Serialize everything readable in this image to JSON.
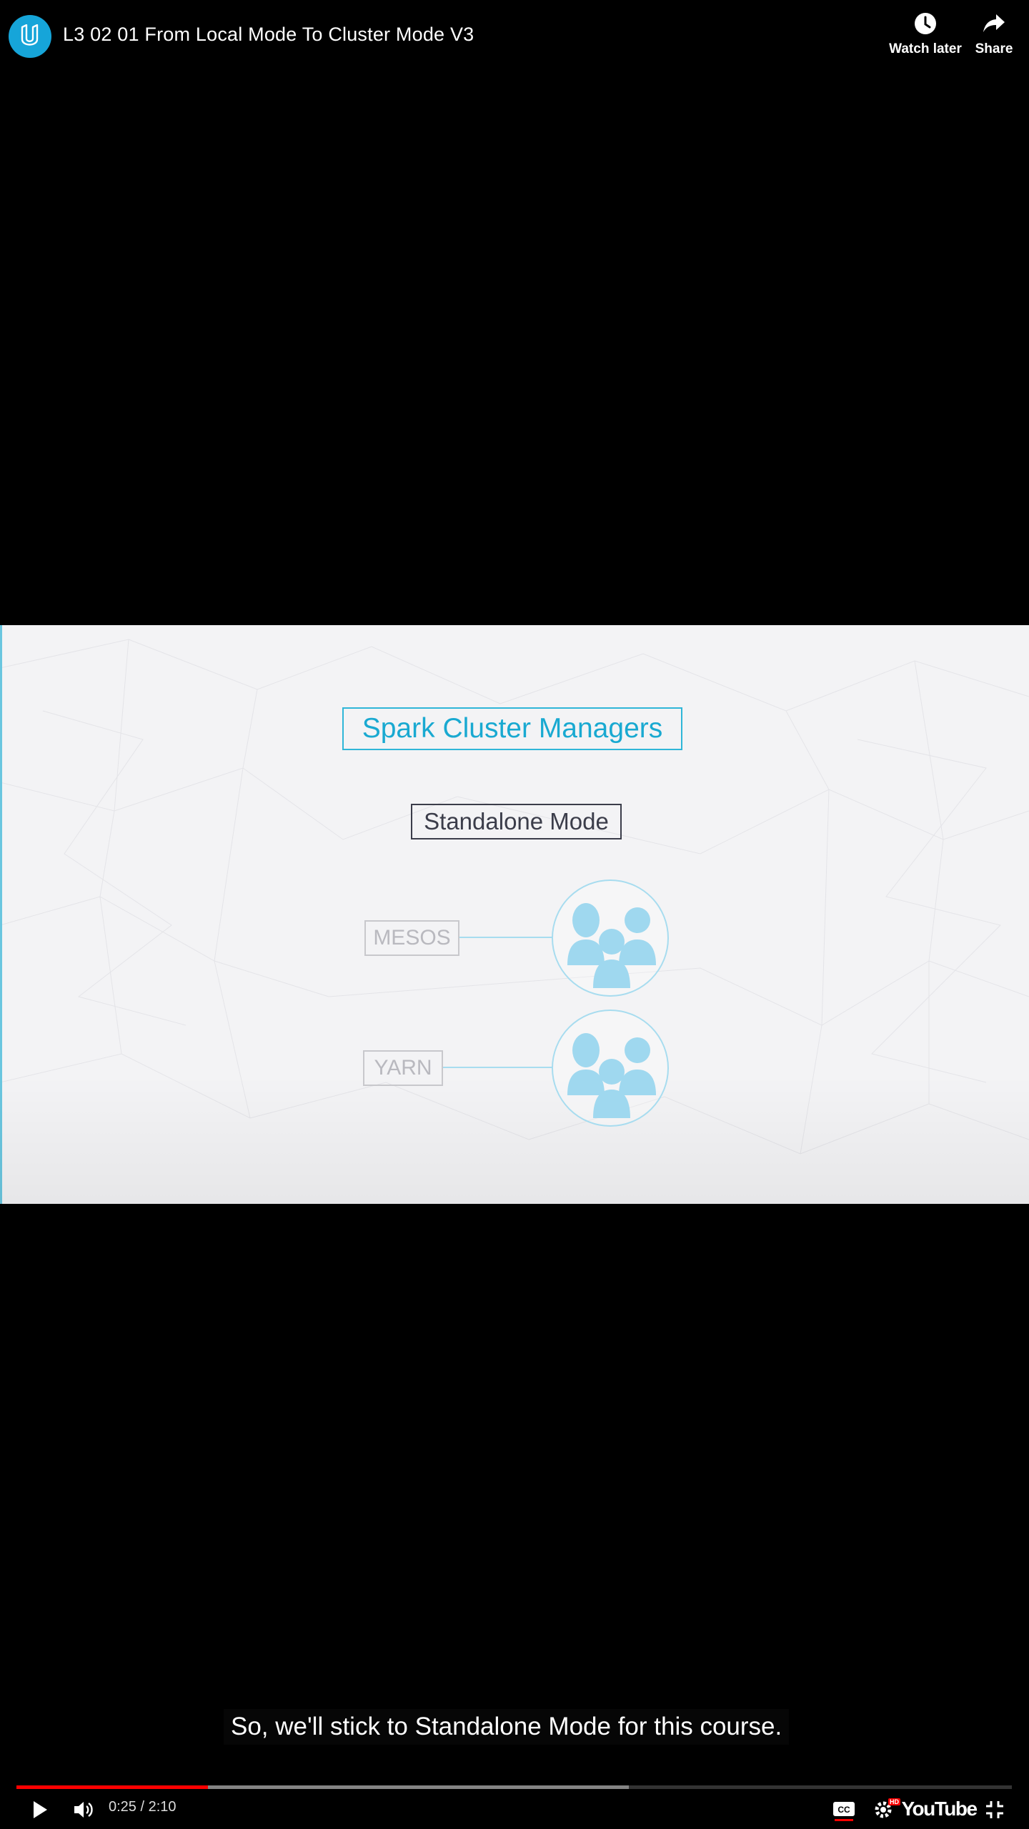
{
  "player": {
    "title": "L3 02 01 From Local Mode To Cluster Mode V3",
    "watch_later_label": "Watch later",
    "share_label": "Share",
    "time_display": "0:25 / 2:10",
    "played_fraction": 0.1927,
    "buffered_fraction": 0.6154,
    "brand_label": "YouTube",
    "hd_badge": "HD"
  },
  "slide": {
    "title": "Spark Cluster Managers",
    "standalone_label": "Standalone Mode",
    "managers": [
      "MESOS",
      "YARN"
    ]
  },
  "caption": {
    "text": "So, we'll stick to Standalone Mode for this course."
  },
  "colors": {
    "accent": "#16a5d9",
    "progress": "#ff0000",
    "slide_title": "#19a9d1",
    "people_icon": "#9fd8ef"
  }
}
